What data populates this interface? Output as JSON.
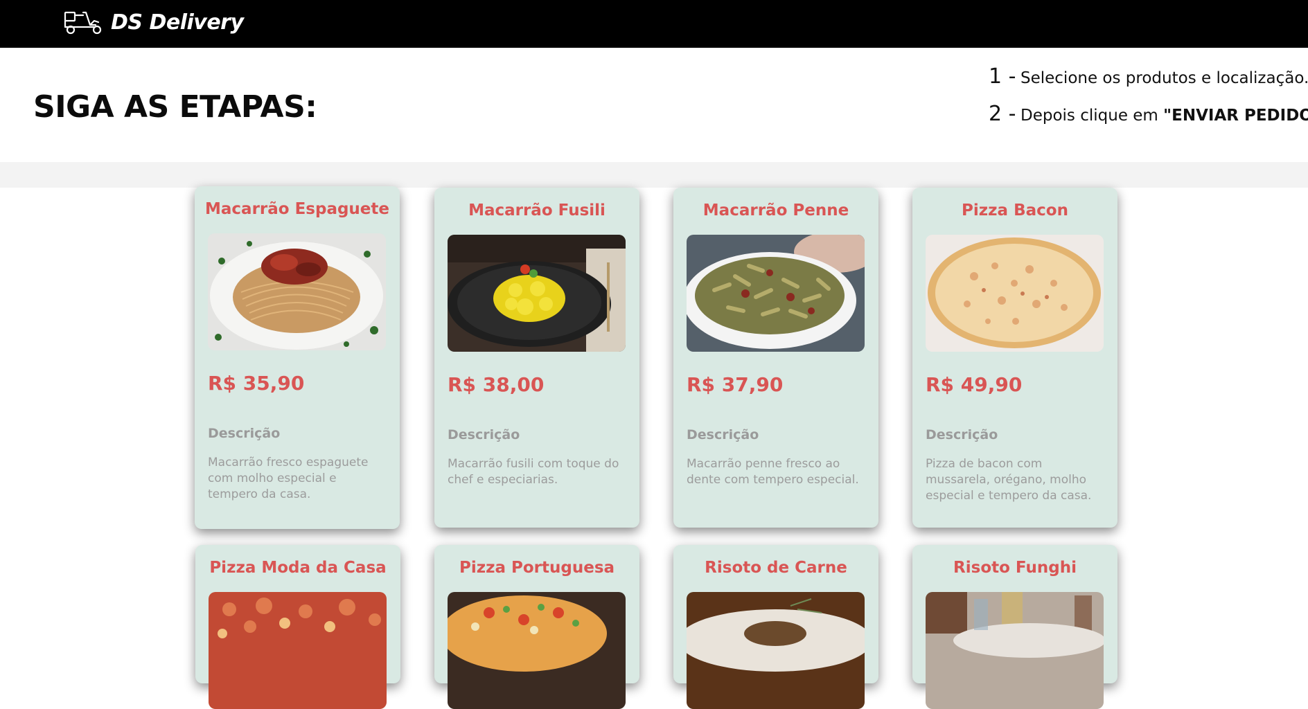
{
  "navbar": {
    "brand": "DS Delivery",
    "logo_icon": "delivery-scooter-icon"
  },
  "steps": {
    "title": "SIGA AS ETAPAS:",
    "items": [
      {
        "number": "1 -",
        "text": "Selecione os produtos e localização.",
        "bold": ""
      },
      {
        "number": "2 -",
        "text": "Depois clique em ",
        "bold": "\"ENVIAR PEDIDO\""
      }
    ]
  },
  "products": [
    {
      "name": "Macarrão Espaguete",
      "price": "R$ 35,90",
      "desc_title": "Descrição",
      "desc": "Macarrão fresco espaguete com molho especial e tempero da casa."
    },
    {
      "name": "Macarrão Fusili",
      "price": "R$ 38,00",
      "desc_title": "Descrição",
      "desc": "Macarrão fusili com toque do chef e especiarias."
    },
    {
      "name": "Macarrão Penne",
      "price": "R$ 37,90",
      "desc_title": "Descrição",
      "desc": "Macarrão penne fresco ao dente com tempero especial."
    },
    {
      "name": "Pizza Bacon",
      "price": "R$ 49,90",
      "desc_title": "Descrição",
      "desc": "Pizza de bacon com mussarela, orégano, molho especial e tempero da casa."
    },
    {
      "name": "Pizza Moda da Casa",
      "price": "",
      "desc_title": "",
      "desc": ""
    },
    {
      "name": "Pizza Portuguesa",
      "price": "",
      "desc_title": "",
      "desc": ""
    },
    {
      "name": "Risoto de Carne",
      "price": "",
      "desc_title": "",
      "desc": ""
    },
    {
      "name": "Risoto Funghi",
      "price": "",
      "desc_title": "",
      "desc": ""
    }
  ],
  "colors": {
    "accent": "#d95554",
    "card_bg": "#d9e9e3",
    "navbar_bg": "#000000"
  }
}
